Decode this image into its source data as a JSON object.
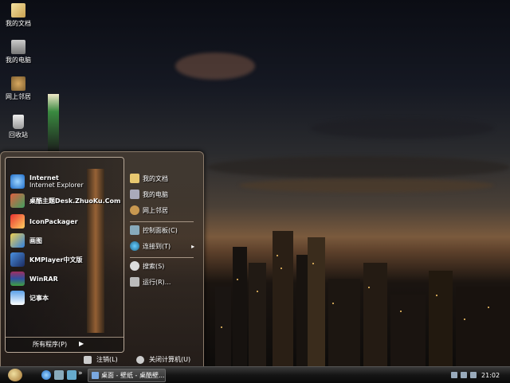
{
  "desktop": {
    "icons": [
      {
        "label": "我的文档",
        "icon": "my-documents-icon"
      },
      {
        "label": "我的电脑",
        "icon": "my-computer-icon"
      },
      {
        "label": "网上邻居",
        "icon": "network-places-icon"
      },
      {
        "label": "回收站",
        "icon": "recycle-bin-icon"
      }
    ]
  },
  "start_menu": {
    "pinned": [
      {
        "title": "Internet",
        "subtitle": "Internet Explorer",
        "icon": "internet-explorer-icon"
      },
      {
        "title": "桌酷主题Desk.ZhuoKu.Com",
        "icon": "zhuoku-theme-icon"
      }
    ],
    "recent": [
      {
        "title": "IconPackager",
        "icon": "iconpackager-icon"
      },
      {
        "title": "画图",
        "icon": "paint-icon"
      },
      {
        "title": "KMPlayer中文版",
        "icon": "kmplayer-icon"
      },
      {
        "title": "WinRAR",
        "icon": "winrar-icon"
      },
      {
        "title": "记事本",
        "icon": "notepad-icon"
      }
    ],
    "all_programs": "所有程序(P)",
    "right": [
      {
        "label": "我的文档",
        "icon": "folder-icon"
      },
      {
        "label": "我的电脑",
        "icon": "computer-icon"
      },
      {
        "label": "网上邻居",
        "icon": "network-icon"
      },
      {
        "label": "控制面板(C)",
        "icon": "control-panel-icon"
      },
      {
        "label": "连接到(T)",
        "icon": "connect-icon",
        "arrow": "▸"
      },
      {
        "label": "搜索(S)",
        "icon": "search-icon"
      },
      {
        "label": "运行(R)...",
        "icon": "run-icon"
      }
    ],
    "logoff": "注销(L)",
    "shutdown": "关闭计算机(U)"
  },
  "taskbar": {
    "chevron": "»",
    "task_label": "桌面 - 壁纸 - 桌酷壁...",
    "clock": "21:02"
  }
}
